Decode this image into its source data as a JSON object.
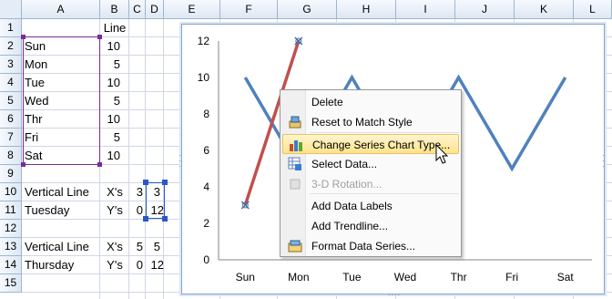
{
  "columns": [
    "A",
    "B",
    "C",
    "D",
    "E",
    "F",
    "G",
    "H",
    "I",
    "J",
    "K",
    "L"
  ],
  "rows": [
    "1",
    "2",
    "3",
    "4",
    "5",
    "6",
    "7",
    "8",
    "9",
    "10",
    "11",
    "12",
    "13",
    "14",
    "15"
  ],
  "sheet": {
    "b1": "Line",
    "days": [
      {
        "label": "Sun",
        "value": "10"
      },
      {
        "label": "Mon",
        "value": "5"
      },
      {
        "label": "Tue",
        "value": "10"
      },
      {
        "label": "Wed",
        "value": "5"
      },
      {
        "label": "Thr",
        "value": "10"
      },
      {
        "label": "Fri",
        "value": "5"
      },
      {
        "label": "Sat",
        "value": "10"
      }
    ],
    "r10": {
      "a": "Vertical Line",
      "b": "X's",
      "c": "3",
      "d": "3"
    },
    "r11": {
      "a": "Tuesday",
      "b": "Y's",
      "c": "0",
      "d": "12"
    },
    "r13": {
      "a": "Vertical Line",
      "b": "X's",
      "c": "5",
      "d": "5"
    },
    "r14": {
      "a": "Thursday",
      "b": "Y's",
      "c": "0",
      "d": "12"
    }
  },
  "chart_data": {
    "type": "line",
    "categories": [
      "Sun",
      "Mon",
      "Tue",
      "Wed",
      "Thr",
      "Fri",
      "Sat"
    ],
    "y_ticks": [
      "0",
      "2",
      "4",
      "6",
      "8",
      "10",
      "12"
    ],
    "ylim": [
      0,
      12
    ],
    "grid": false,
    "series": [
      {
        "values": [
          10,
          5,
          10,
          5,
          10,
          5,
          10
        ],
        "color": "#4f81bd"
      },
      {
        "points": [
          {
            "x": "Sun",
            "y": 3
          },
          {
            "x": "Mon",
            "y": 12
          }
        ],
        "color": "#c0504d"
      }
    ]
  },
  "context_menu": {
    "items": [
      {
        "label": "Delete",
        "icon": "",
        "disabled": false,
        "hover": false
      },
      {
        "label": "Reset to Match Style",
        "icon": "reset-style-icon",
        "disabled": false,
        "hover": false
      },
      {
        "label": "Change Series Chart Type...",
        "icon": "chart-type-icon",
        "disabled": false,
        "hover": true
      },
      {
        "label": "Select Data...",
        "icon": "select-data-icon",
        "disabled": false,
        "hover": false
      },
      {
        "label": "3-D Rotation...",
        "icon": "rotation-icon",
        "disabled": true,
        "hover": false
      },
      {
        "label": "Add Data Labels",
        "icon": "",
        "disabled": false,
        "hover": false
      },
      {
        "label": "Add Trendline...",
        "icon": "",
        "disabled": false,
        "hover": false
      },
      {
        "label": "Format Data Series...",
        "icon": "format-series-icon",
        "disabled": false,
        "hover": false
      }
    ]
  }
}
